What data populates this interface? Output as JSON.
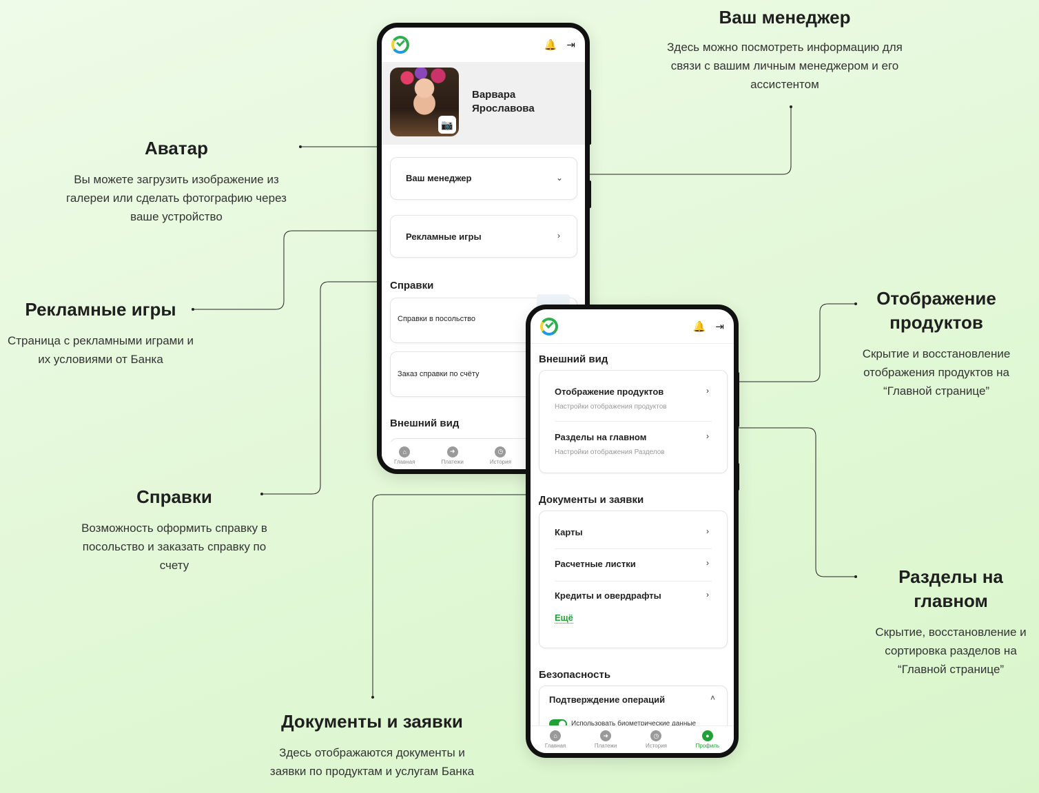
{
  "annotations": {
    "manager": {
      "title": "Ваш менеджер",
      "text": "Здесь можно посмотреть информацию для связи с вашим личным менеджером и его ассистентом"
    },
    "avatar": {
      "title": "Аватар",
      "text": "Вы можете загрузить изображение из галереи или сделать фотографию через ваше устройство"
    },
    "games": {
      "title": "Рекламные игры",
      "text": "Страница с рекламными играми и их условиями от Банка"
    },
    "certificates": {
      "title": "Справки",
      "text": "Возможность оформить справку в посольство и заказать справку по счету"
    },
    "products": {
      "title": "Отображение продуктов",
      "text": "Скрытие и восстановление отображения продуктов на “Главной странице”"
    },
    "sections": {
      "title": "Разделы на главном",
      "text": "Скрытие, восстановление и сортировка разделов на “Главной странице”"
    },
    "documents": {
      "title": "Документы и заявки",
      "text": "Здесь отображаются документы и заявки по продуктам и услугам Банка"
    }
  },
  "phone1": {
    "profile_name": "Варвара Ярославова",
    "manager_label": "Ваш менеджер",
    "games_label": "Рекламные игры",
    "certificates_title": "Справки",
    "cert_embassy": "Справки в посольство",
    "cert_account": "Заказ справки по счёту",
    "appearance_title": "Внешний вид",
    "tabs": [
      "Главная",
      "Платежи",
      "История"
    ]
  },
  "phone2": {
    "appearance_title": "Внешний вид",
    "products_label": "Отображение продуктов",
    "products_sub": "Настройки отображения продуктов",
    "sections_label": "Разделы на главном",
    "sections_sub": "Настройки отображения Разделов",
    "documents_title": "Документы и заявки",
    "doc_items": [
      "Карты",
      "Расчетные листки",
      "Кредиты и овердрафты"
    ],
    "more_label": "Ещё",
    "security_title": "Безопасность",
    "confirm_label": "Подтверждение операций",
    "biometric_label": "Использовать биометрические данные",
    "tabs": [
      "Главная",
      "Платежи",
      "История",
      "Профиль"
    ]
  },
  "colors": {
    "accent": "#21a038",
    "background": "#e3f8d8"
  },
  "icons": {
    "bell": "bell-icon",
    "logout": "logout-icon",
    "camera": "camera-icon",
    "chevron": "chevron-right-icon"
  }
}
